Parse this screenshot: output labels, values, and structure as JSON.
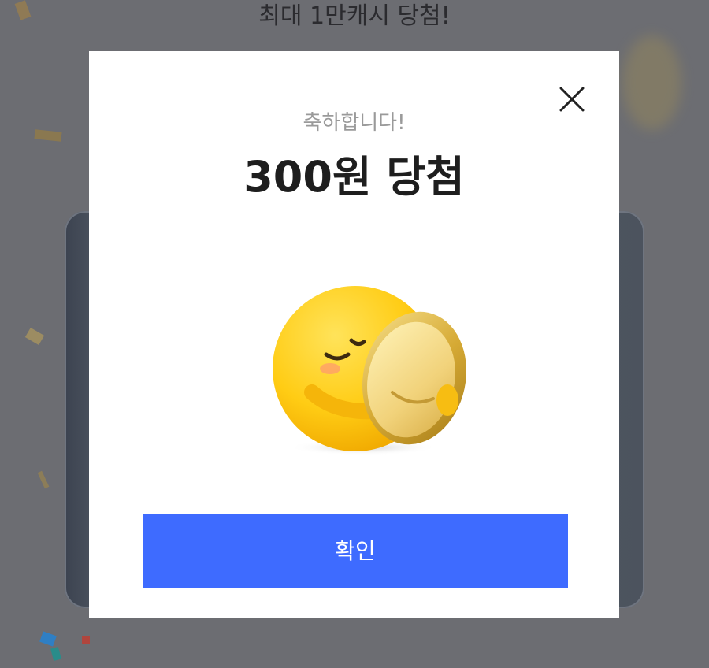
{
  "background": {
    "headline": "최대 1만캐시 당첨!"
  },
  "modal": {
    "close_icon": "close-icon",
    "congrats_text": "축하합니다!",
    "prize_title": "300원 당첨",
    "illustration_icon": "smiley-hugging-coin-icon",
    "confirm_label": "확인"
  },
  "colors": {
    "accent": "#3E6BFF",
    "overlay": "#6C6D72",
    "title": "#1E1E1E",
    "subtitle": "#9A9A9A"
  }
}
